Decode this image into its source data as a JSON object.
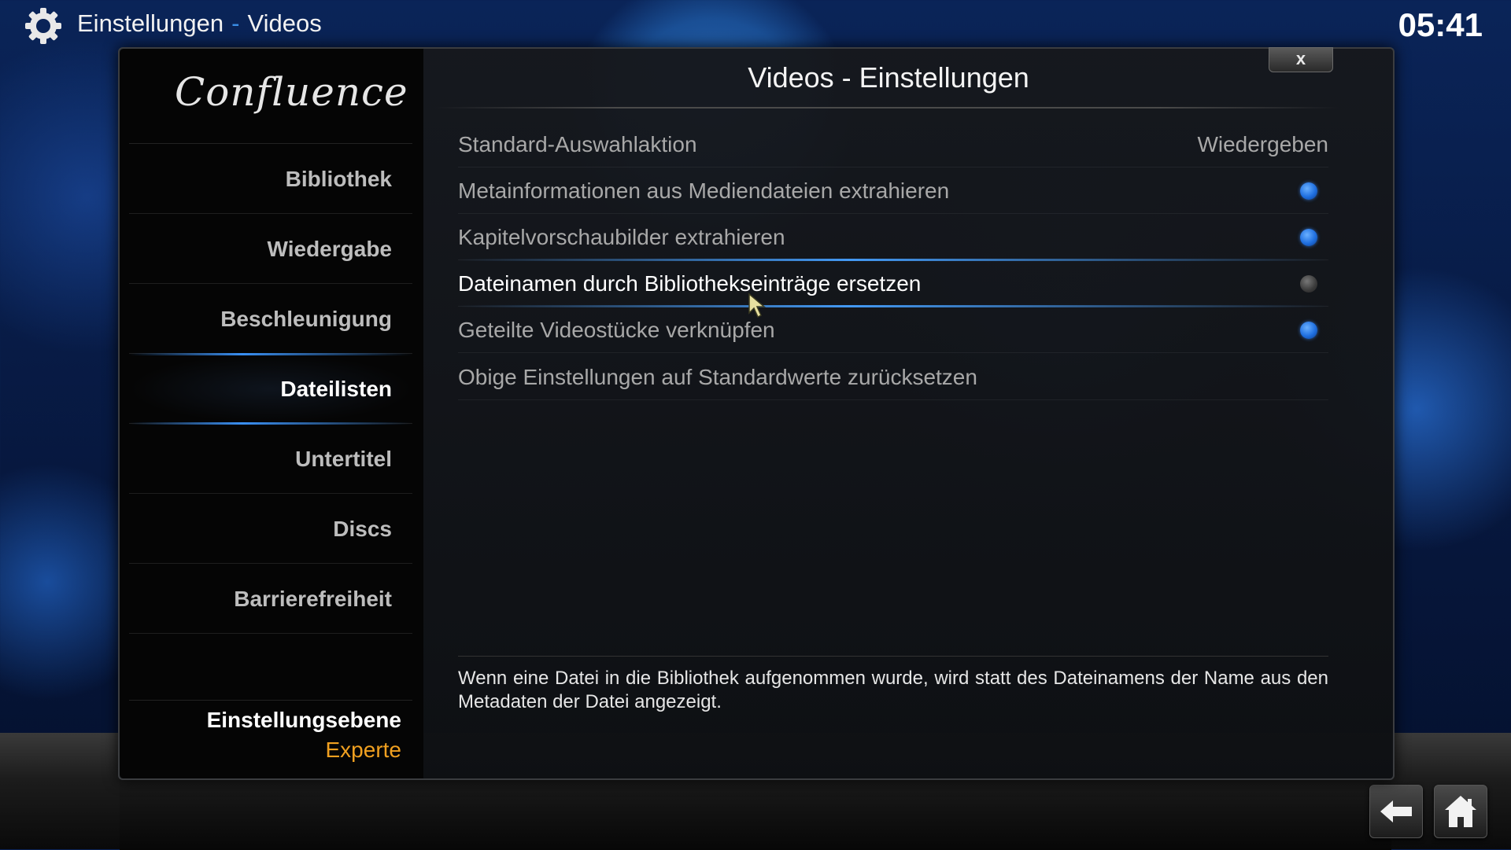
{
  "topbar": {
    "section": "Einstellungen",
    "separator": "-",
    "subsection": "Videos",
    "clock": "05:41",
    "icon": "gear-icon"
  },
  "sidebar": {
    "logo": "Confluence",
    "items": [
      {
        "label": "Bibliothek",
        "active": false
      },
      {
        "label": "Wiedergabe",
        "active": false
      },
      {
        "label": "Beschleunigung",
        "active": false
      },
      {
        "label": "Dateilisten",
        "active": true
      },
      {
        "label": "Untertitel",
        "active": false
      },
      {
        "label": "Discs",
        "active": false
      },
      {
        "label": "Barrierefreiheit",
        "active": false
      }
    ],
    "level_label": "Einstellungsebene",
    "level_value": "Experte"
  },
  "dialog": {
    "title": "Videos - Einstellungen",
    "close_label": "x",
    "settings": [
      {
        "label": "Standard-Auswahlaktion",
        "value": "Wiedergeben"
      },
      {
        "label": "Metainformationen aus Mediendateien extrahieren",
        "toggle": true
      },
      {
        "label": "Kapitelvorschaubilder extrahieren",
        "toggle": true
      },
      {
        "label": "Dateinamen durch Bibliothekseinträge ersetzen",
        "toggle": false,
        "focused": true
      },
      {
        "label": "Geteilte Videostücke verknüpfen",
        "toggle": true
      },
      {
        "label": "Obige Einstellungen auf Standardwerte zurücksetzen"
      }
    ],
    "description": "Wenn eine Datei in die Bibliothek aufgenommen wurde, wird statt des Dateinamens der Name aus den Metadaten der Datei angezeigt."
  },
  "colors": {
    "accent": "#3a8ee6",
    "toggle_on": "#1f6fe0",
    "level_value": "#f0a020"
  },
  "bottom": {
    "back_icon": "back-arrow-icon",
    "home_icon": "home-icon"
  }
}
